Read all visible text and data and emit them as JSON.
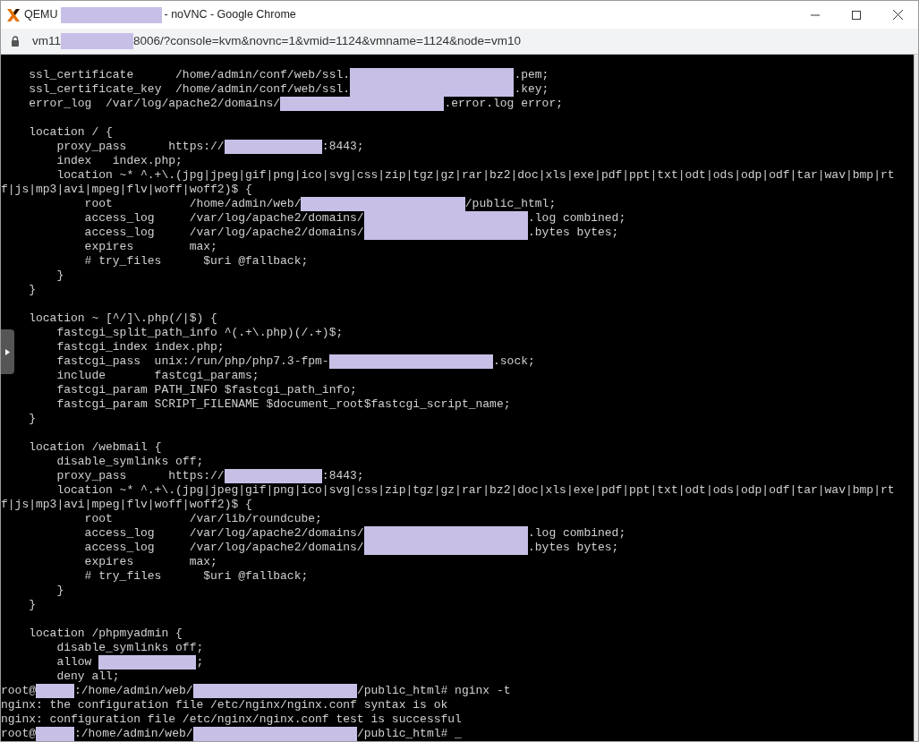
{
  "window": {
    "title": [
      {
        "kind": "text",
        "text": "QEMU"
      },
      {
        "kind": "redacted"
      },
      {
        "kind": "text",
        "text": "- noVNC - Google Chrome"
      }
    ]
  },
  "address_bar": {
    "url": [
      {
        "kind": "text",
        "text": "vm11"
      },
      {
        "kind": "redacted"
      },
      {
        "kind": "text",
        "text": "8006/?console=kvm&novnc=1&vmid=1124&vmname=1124&node=vm10"
      }
    ]
  },
  "terminal": {
    "lines": [
      {
        "kind": "code",
        "segments": [
          {
            "kind": "text",
            "text": "    ssl_certificate      /home/admin/conf/web/ssl."
          },
          {
            "kind": "redacted-long"
          },
          {
            "kind": "text",
            "text": ".pem;"
          }
        ]
      },
      {
        "kind": "code",
        "segments": [
          {
            "kind": "text",
            "text": "    ssl_certificate_key  /home/admin/conf/web/ssl."
          },
          {
            "kind": "redacted-long"
          },
          {
            "kind": "text",
            "text": ".key;"
          }
        ]
      },
      {
        "kind": "code",
        "segments": [
          {
            "kind": "text",
            "text": "    error_log  /var/log/apache2/domains/"
          },
          {
            "kind": "redacted-long"
          },
          {
            "kind": "text",
            "text": ".error.log error;"
          }
        ]
      },
      {
        "kind": "blank"
      },
      {
        "kind": "code",
        "segments": [
          {
            "kind": "text",
            "text": "    location / {"
          }
        ]
      },
      {
        "kind": "code",
        "segments": [
          {
            "kind": "text",
            "text": "        proxy_pass      https://"
          },
          {
            "kind": "redacted-medium"
          },
          {
            "kind": "text",
            "text": ":8443;"
          }
        ]
      },
      {
        "kind": "code",
        "segments": [
          {
            "kind": "text",
            "text": "        index   index.php;"
          }
        ]
      },
      {
        "kind": "code",
        "segments": [
          {
            "kind": "text",
            "text": "        location ~* ^.+\\.(jpg|jpeg|gif|png|ico|svg|css|zip|tgz|gz|rar|bz2|doc|xls|exe|pdf|ppt|txt|odt|ods|odp|odf|tar|wav|bmp|rt"
          }
        ]
      },
      {
        "kind": "code",
        "segments": [
          {
            "kind": "text",
            "text": "f|js|mp3|avi|mpeg|flv|woff|woff2)$ {"
          }
        ]
      },
      {
        "kind": "code",
        "segments": [
          {
            "kind": "text",
            "text": "            root           /home/admin/web/"
          },
          {
            "kind": "redacted-long"
          },
          {
            "kind": "text",
            "text": "/public_html;"
          }
        ]
      },
      {
        "kind": "code",
        "segments": [
          {
            "kind": "text",
            "text": "            access_log     /var/log/apache2/domains/"
          },
          {
            "kind": "redacted-long"
          },
          {
            "kind": "text",
            "text": ".log combined;"
          }
        ]
      },
      {
        "kind": "code",
        "segments": [
          {
            "kind": "text",
            "text": "            access_log     /var/log/apache2/domains/"
          },
          {
            "kind": "redacted-long"
          },
          {
            "kind": "text",
            "text": ".bytes bytes;"
          }
        ]
      },
      {
        "kind": "code",
        "segments": [
          {
            "kind": "text",
            "text": "            expires        max;"
          }
        ]
      },
      {
        "kind": "code",
        "segments": [
          {
            "kind": "text",
            "text": "            # try_files      $uri @fallback;"
          }
        ]
      },
      {
        "kind": "code",
        "segments": [
          {
            "kind": "text",
            "text": "        }"
          }
        ]
      },
      {
        "kind": "code",
        "segments": [
          {
            "kind": "text",
            "text": "    }"
          }
        ]
      },
      {
        "kind": "blank"
      },
      {
        "kind": "code",
        "segments": [
          {
            "kind": "text",
            "text": "    location ~ [^/]\\.php(/|$) {"
          }
        ]
      },
      {
        "kind": "code",
        "segments": [
          {
            "kind": "text",
            "text": "        fastcgi_split_path_info ^(.+\\.php)(/.+)$;"
          }
        ]
      },
      {
        "kind": "code",
        "segments": [
          {
            "kind": "text",
            "text": "        fastcgi_index index.php;"
          }
        ]
      },
      {
        "kind": "code",
        "segments": [
          {
            "kind": "text",
            "text": "        fastcgi_pass  unix:/run/php/php7.3-fpm-"
          },
          {
            "kind": "redacted-long"
          },
          {
            "kind": "text",
            "text": ".sock;"
          }
        ]
      },
      {
        "kind": "code",
        "segments": [
          {
            "kind": "text",
            "text": "        include       fastcgi_params;"
          }
        ]
      },
      {
        "kind": "code",
        "segments": [
          {
            "kind": "text",
            "text": "        fastcgi_param PATH_INFO $fastcgi_path_info;"
          }
        ]
      },
      {
        "kind": "code",
        "segments": [
          {
            "kind": "text",
            "text": "        fastcgi_param SCRIPT_FILENAME $document_root$fastcgi_script_name;"
          }
        ]
      },
      {
        "kind": "code",
        "segments": [
          {
            "kind": "text",
            "text": "    }"
          }
        ]
      },
      {
        "kind": "blank"
      },
      {
        "kind": "code",
        "segments": [
          {
            "kind": "text",
            "text": "    location /webmail {"
          }
        ]
      },
      {
        "kind": "code",
        "segments": [
          {
            "kind": "text",
            "text": "        disable_symlinks off;"
          }
        ]
      },
      {
        "kind": "code",
        "segments": [
          {
            "kind": "text",
            "text": "        proxy_pass      https://"
          },
          {
            "kind": "redacted-medium"
          },
          {
            "kind": "text",
            "text": ":8443;"
          }
        ]
      },
      {
        "kind": "code",
        "segments": [
          {
            "kind": "text",
            "text": "        location ~* ^.+\\.(jpg|jpeg|gif|png|ico|svg|css|zip|tgz|gz|rar|bz2|doc|xls|exe|pdf|ppt|txt|odt|ods|odp|odf|tar|wav|bmp|rt"
          }
        ]
      },
      {
        "kind": "code",
        "segments": [
          {
            "kind": "text",
            "text": "f|js|mp3|avi|mpeg|flv|woff|woff2)$ {"
          }
        ]
      },
      {
        "kind": "code",
        "segments": [
          {
            "kind": "text",
            "text": "            root           /var/lib/roundcube;"
          }
        ]
      },
      {
        "kind": "code",
        "segments": [
          {
            "kind": "text",
            "text": "            access_log     /var/log/apache2/domains/"
          },
          {
            "kind": "redacted-long"
          },
          {
            "kind": "text",
            "text": ".log combined;"
          }
        ]
      },
      {
        "kind": "code",
        "segments": [
          {
            "kind": "text",
            "text": "            access_log     /var/log/apache2/domains/"
          },
          {
            "kind": "redacted-long"
          },
          {
            "kind": "text",
            "text": ".bytes bytes;"
          }
        ]
      },
      {
        "kind": "code",
        "segments": [
          {
            "kind": "text",
            "text": "            expires        max;"
          }
        ]
      },
      {
        "kind": "code",
        "segments": [
          {
            "kind": "text",
            "text": "            # try_files      $uri @fallback;"
          }
        ]
      },
      {
        "kind": "code",
        "segments": [
          {
            "kind": "text",
            "text": "        }"
          }
        ]
      },
      {
        "kind": "code",
        "segments": [
          {
            "kind": "text",
            "text": "    }"
          }
        ]
      },
      {
        "kind": "blank"
      },
      {
        "kind": "code",
        "segments": [
          {
            "kind": "text",
            "text": "    location /phpmyadmin {"
          }
        ]
      },
      {
        "kind": "code",
        "segments": [
          {
            "kind": "text",
            "text": "        disable_symlinks off;"
          }
        ]
      },
      {
        "kind": "code",
        "segments": [
          {
            "kind": "text",
            "text": "        allow "
          },
          {
            "kind": "redacted-medium"
          },
          {
            "kind": "text",
            "text": ";"
          }
        ]
      },
      {
        "kind": "code",
        "segments": [
          {
            "kind": "text",
            "text": "        deny all;"
          }
        ]
      },
      {
        "kind": "code",
        "segments": [
          {
            "kind": "text",
            "text": "root@"
          },
          {
            "kind": "redacted-short"
          },
          {
            "kind": "text",
            "text": ":/home/admin/web/"
          },
          {
            "kind": "redacted-long"
          },
          {
            "kind": "text",
            "text": "/public_html# nginx -t"
          }
        ]
      },
      {
        "kind": "code",
        "segments": [
          {
            "kind": "text",
            "text": "nginx: the configuration file /etc/nginx/nginx.conf syntax is ok"
          }
        ]
      },
      {
        "kind": "code",
        "segments": [
          {
            "kind": "text",
            "text": "nginx: configuration file /etc/nginx/nginx.conf test is successful"
          }
        ]
      },
      {
        "kind": "code",
        "segments": [
          {
            "kind": "text",
            "text": "root@"
          },
          {
            "kind": "redacted-short"
          },
          {
            "kind": "text",
            "text": ":/home/admin/web/"
          },
          {
            "kind": "redacted-long"
          },
          {
            "kind": "text",
            "text": "/public_html# _"
          }
        ]
      }
    ]
  }
}
